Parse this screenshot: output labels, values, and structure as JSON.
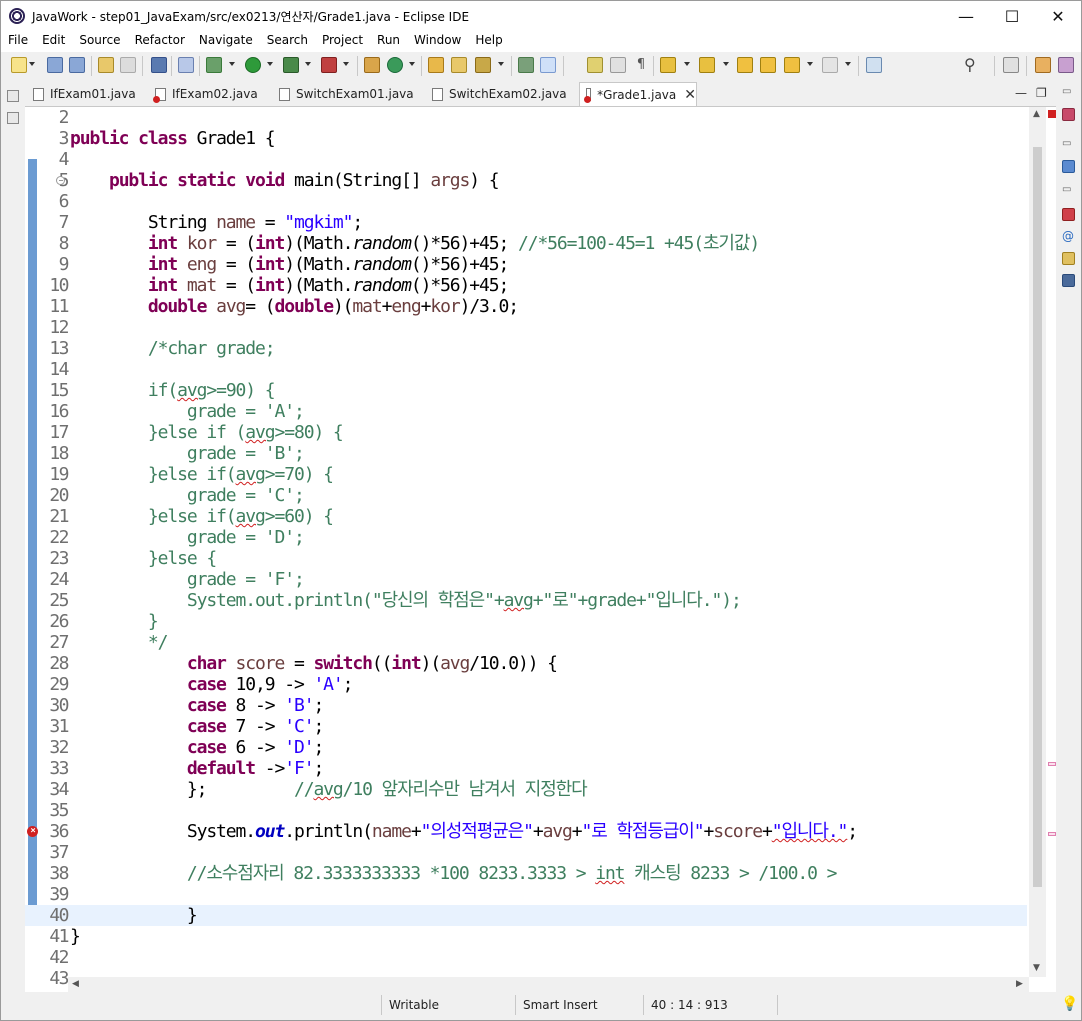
{
  "window": {
    "title": "JavaWork - step01_JavaExam/src/ex0213/연산자/Grade1.java - Eclipse IDE",
    "minimize": "—",
    "maximize": "☐",
    "close": "✕"
  },
  "menu": [
    "File",
    "Edit",
    "Source",
    "Refactor",
    "Navigate",
    "Search",
    "Project",
    "Run",
    "Window",
    "Help"
  ],
  "tabs": [
    {
      "label": "IfExam01.java",
      "error": false
    },
    {
      "label": "IfExam02.java",
      "error": true
    },
    {
      "label": "SwitchExam01.java",
      "error": false
    },
    {
      "label": "SwitchExam02.java",
      "error": false
    },
    {
      "label": "*Grade1.java",
      "error": true,
      "active": true
    }
  ],
  "editor": {
    "current_line": 40,
    "error_line": 36,
    "lines": [
      {
        "n": "2",
        "html": ""
      },
      {
        "n": "3",
        "html": "<span class=\"kw\">public</span> <span class=\"kw\">class</span> Grade1 {"
      },
      {
        "n": "4",
        "html": ""
      },
      {
        "n": "5",
        "html": "    <span class=\"kw\">public</span> <span class=\"kw\">static</span> <span class=\"kw\">void</span> main(String[] <span class=\"vr\">args</span>) {"
      },
      {
        "n": "6",
        "html": ""
      },
      {
        "n": "7",
        "html": "        String <span class=\"vr\">name</span> = <span class=\"st\">\"mgkim\"</span>;"
      },
      {
        "n": "8",
        "html": "        <span class=\"kw\">int</span> <span class=\"vr\">kor</span> = (<span class=\"kw\">int</span>)(Math.<span class=\"it\">random</span>()*56)+45; <span class=\"cm\">//*56=100-45=1 +45(초기값)</span>"
      },
      {
        "n": "9",
        "html": "        <span class=\"kw\">int</span> <span class=\"vr\">eng</span> = (<span class=\"kw\">int</span>)(Math.<span class=\"it\">random</span>()*56)+45;"
      },
      {
        "n": "10",
        "html": "        <span class=\"kw\">int</span> <span class=\"vr\">mat</span> = (<span class=\"kw\">int</span>)(Math.<span class=\"it\">random</span>()*56)+45;"
      },
      {
        "n": "11",
        "html": "        <span class=\"kw\">double</span> <span class=\"vr\">avg</span>= (<span class=\"kw\">double</span>)(<span class=\"vr\">mat</span>+<span class=\"vr\">eng</span>+<span class=\"vr\">kor</span>)/3.0;"
      },
      {
        "n": "12",
        "html": ""
      },
      {
        "n": "13",
        "html": "        <span class=\"cm\">/*char grade;</span>"
      },
      {
        "n": "14",
        "html": ""
      },
      {
        "n": "15",
        "html": "        <span class=\"cm\">if(<span class=\"sq\">avg</span>&gt;=90) {</span>"
      },
      {
        "n": "16",
        "html": "            <span class=\"cm\">grade = 'A';</span>"
      },
      {
        "n": "17",
        "html": "        <span class=\"cm\">}else if (<span class=\"sq\">avg</span>&gt;=80) {</span>"
      },
      {
        "n": "18",
        "html": "            <span class=\"cm\">grade = 'B';</span>"
      },
      {
        "n": "19",
        "html": "        <span class=\"cm\">}else if(<span class=\"sq\">avg</span>&gt;=70) {</span>"
      },
      {
        "n": "20",
        "html": "            <span class=\"cm\">grade = 'C';</span>"
      },
      {
        "n": "21",
        "html": "        <span class=\"cm\">}else if(<span class=\"sq\">avg</span>&gt;=60) {</span>"
      },
      {
        "n": "22",
        "html": "            <span class=\"cm\">grade = 'D';</span>"
      },
      {
        "n": "23",
        "html": "        <span class=\"cm\">}else {</span>"
      },
      {
        "n": "24",
        "html": "            <span class=\"cm\">grade = 'F';</span>"
      },
      {
        "n": "25",
        "html": "            <span class=\"cm\">System.out.println(\"당신의 학점은\"+<span class=\"sq\">avg</span>+\"로\"+grade+\"입니다.\");</span>"
      },
      {
        "n": "26",
        "html": "        <span class=\"cm\">}</span>"
      },
      {
        "n": "27",
        "html": "        <span class=\"cm\">*/</span>"
      },
      {
        "n": "28",
        "html": "            <span class=\"kw\">char</span> <span class=\"vr\">score</span> = <span class=\"kw\">switch</span>((<span class=\"kw\">int</span>)(<span class=\"vr\">avg</span>/10.0)) {"
      },
      {
        "n": "29",
        "html": "            <span class=\"kw\">case</span> 10,9 -&gt; <span class=\"st\">'A'</span>;"
      },
      {
        "n": "30",
        "html": "            <span class=\"kw\">case</span> 8 -&gt; <span class=\"st\">'B'</span>;"
      },
      {
        "n": "31",
        "html": "            <span class=\"kw\">case</span> 7 -&gt; <span class=\"st\">'C'</span>;"
      },
      {
        "n": "32",
        "html": "            <span class=\"kw\">case</span> 6 -&gt; <span class=\"st\">'D'</span>;"
      },
      {
        "n": "33",
        "html": "            <span class=\"kw\">default</span> -&gt;<span class=\"st\">'F'</span>;"
      },
      {
        "n": "34",
        "html": "            };         <span class=\"cm\">//<span class=\"sq\">avg</span>/10 앞자리수만 남겨서 지정한다</span>"
      },
      {
        "n": "35",
        "html": ""
      },
      {
        "n": "36",
        "html": "            System.<span class=\"fd\">out</span>.println(<span class=\"vr\">name</span>+<span class=\"st\">\"의성적평균은\"</span>+<span class=\"vr\">avg</span>+<span class=\"st\">\"로 학점등급이\"</span>+<span class=\"vr\">score</span>+<span class=\"st\"><span class=\"sq\">\"입니다.\"</span></span>;"
      },
      {
        "n": "37",
        "html": ""
      },
      {
        "n": "38",
        "html": "            <span class=\"cm\">//소수점자리 82.3333333333 *100 8233.3333 &gt; <span class=\"sq\">int</span> 캐스팅 8233 &gt; /100.0 &gt;</span>"
      },
      {
        "n": "39",
        "html": ""
      },
      {
        "n": "40",
        "html": "            }"
      },
      {
        "n": "41",
        "html": "}"
      },
      {
        "n": "42",
        "html": ""
      },
      {
        "n": "43",
        "html": ""
      }
    ]
  },
  "status": {
    "writable": "Writable",
    "insert_mode": "Smart Insert",
    "position": "40 : 14 : 913"
  },
  "colors": {
    "keyword": "#7f0055",
    "string": "#2a00ff",
    "comment": "#3f7f5f",
    "change_bar": "#6b9bd2",
    "current_line": "#e8f2fe"
  }
}
